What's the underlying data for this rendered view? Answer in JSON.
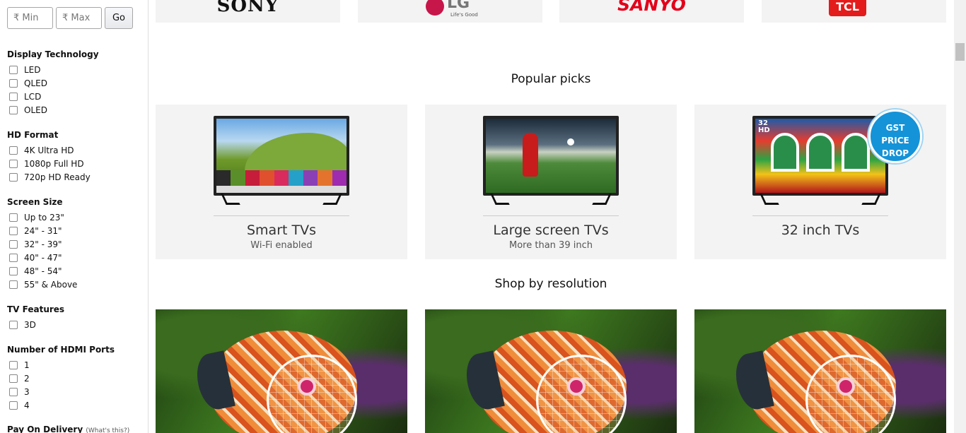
{
  "price_filter": {
    "min_placeholder": "₹ Min",
    "max_placeholder": "₹ Max",
    "go_label": "Go"
  },
  "filters": {
    "display_technology": {
      "title": "Display Technology",
      "options": [
        "LED",
        "QLED",
        "LCD",
        "OLED"
      ]
    },
    "hd_format": {
      "title": "HD Format",
      "options": [
        "4K Ultra HD",
        "1080p Full HD",
        "720p HD Ready"
      ]
    },
    "screen_size": {
      "title": "Screen Size",
      "options": [
        "Up to 23\"",
        "24\" - 31\"",
        "32\" - 39\"",
        "40\" - 47\"",
        "48\" - 54\"",
        "55\" & Above"
      ]
    },
    "tv_features": {
      "title": "TV Features",
      "options": [
        "3D"
      ]
    },
    "hdmi_ports": {
      "title": "Number of HDMI Ports",
      "options": [
        "1",
        "2",
        "3",
        "4"
      ]
    },
    "pay_on_delivery": {
      "title": "Pay On Delivery",
      "hint": "(What's this?)"
    }
  },
  "brands": {
    "sony": "SONY",
    "lg": "LG",
    "lg_tagline": "Life's Good",
    "sanyo": "SANYO",
    "tcl": "TCL"
  },
  "popular_picks": {
    "heading": "Popular picks",
    "cards": [
      {
        "title": "Smart TVs",
        "subtitle": "Wi-Fi enabled"
      },
      {
        "title": "Large screen TVs",
        "subtitle": "More than 39 inch"
      },
      {
        "title": "32 inch TVs",
        "subtitle": ""
      }
    ],
    "badge": {
      "line1": "GST",
      "line2": "PRICE",
      "line3": "DROP"
    },
    "screen_badge": {
      "line1": "32",
      "line2": "HD"
    }
  },
  "shop_by_resolution": {
    "heading": "Shop by resolution"
  },
  "colors": {
    "sanyo_red": "#e2001a",
    "lg_magenta": "#c6164a",
    "tcl_red": "#e41b1b",
    "gst_blue": "#1493d8"
  }
}
